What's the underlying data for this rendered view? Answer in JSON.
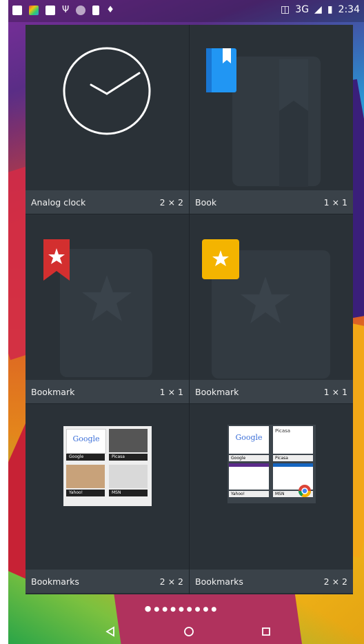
{
  "status_bar": {
    "network": "3G",
    "time": "2:34"
  },
  "widgets": [
    {
      "name": "Analog clock",
      "size": "2 × 2",
      "icon": "analog-clock-icon"
    },
    {
      "name": "Book",
      "size": "1 × 1",
      "icon": "book-icon"
    },
    {
      "name": "Bookmark",
      "size": "1 × 1",
      "icon": "bookmark-red-icon"
    },
    {
      "name": "Bookmark",
      "size": "1 × 1",
      "icon": "bookmark-yellow-icon"
    },
    {
      "name": "Bookmarks",
      "size": "2 × 2",
      "icon": "bookmarks-grid-preview"
    },
    {
      "name": "Bookmarks",
      "size": "2 × 2",
      "icon": "bookmarks-grid-preview-chrome"
    }
  ],
  "page_indicator": {
    "pages": 9,
    "current": 1
  },
  "colors": {
    "panel": "#262d33",
    "label_bar": "#3a4249",
    "book_blue": "#2196f3",
    "bookmark_red": "#d32f2f",
    "bookmark_yellow": "#f4b400"
  },
  "thumb_text": {
    "google": "Google",
    "picasa": "Picasa",
    "yahoo": "Yahoo!",
    "msn": "MSN"
  }
}
